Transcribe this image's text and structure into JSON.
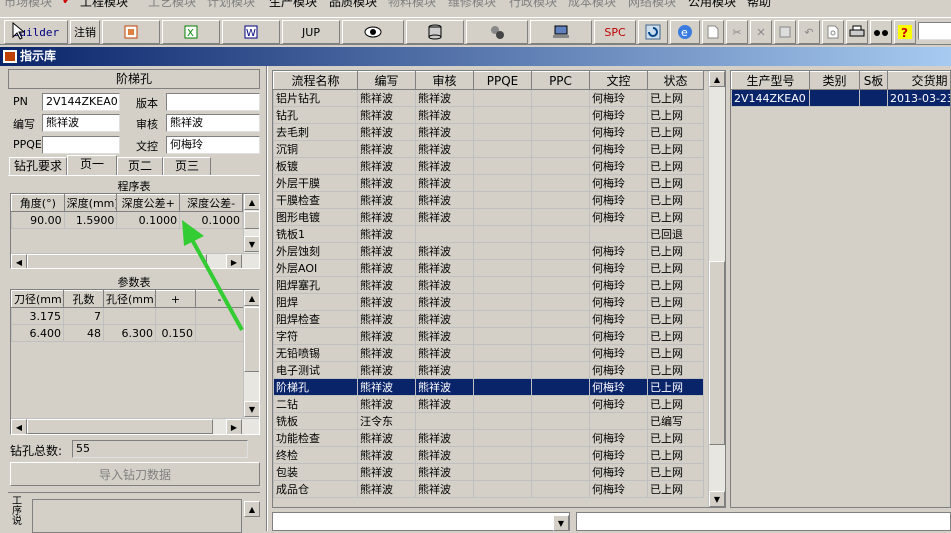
{
  "menu": [
    "市场模块",
    "工程模块",
    "工艺模块",
    "计划模块",
    "生产模块",
    "品质模块",
    "物料模块",
    "维修模块",
    "行政模块",
    "成本模块",
    "网络模块",
    "公用模块",
    "帮助"
  ],
  "toolbar": {
    "builder": "Builder",
    "logout": "注销",
    "jup": "JUP",
    "spc": "SPC"
  },
  "window_title": "指示库",
  "left": {
    "header": "阶梯孔",
    "pn_label": "PN",
    "pn_value": "2V144ZKEA0",
    "version_label": "版本",
    "version_value": "",
    "writer_label": "编写",
    "writer_value": "熊祥波",
    "review_label": "审核",
    "review_value": "熊祥波",
    "ppqe_label": "PPQE",
    "ppqe_value": "",
    "doc_label": "文控",
    "doc_value": "何梅玲",
    "tabs": [
      "钻孔要求",
      "页一",
      "页二",
      "页三"
    ],
    "program_title": "程序表",
    "program_headers": [
      "角度(°)",
      "深度(mm)",
      "深度公差+",
      "深度公差-"
    ],
    "program_rows": [
      [
        "90.00",
        "1.5900",
        "0.1000",
        "0.1000"
      ]
    ],
    "param_title": "参数表",
    "param_headers": [
      "刀径(mm)",
      "孔数",
      "孔径(mm)",
      "+",
      "-"
    ],
    "param_rows": [
      [
        "3.175",
        "7",
        "",
        "",
        ""
      ],
      [
        "6.400",
        "48",
        "6.300",
        "0.150",
        ""
      ]
    ],
    "total_label": "钻孔总数:",
    "total_value": "55",
    "import_button": "导入钻刀数据",
    "side_label": "工序说"
  },
  "process_table": {
    "headers": [
      "流程名称",
      "编写",
      "审核",
      "PPQE",
      "PPC",
      "文控",
      "状态"
    ],
    "rows": [
      [
        "铝片钻孔",
        "熊祥波",
        "熊祥波",
        "",
        "",
        "何梅玲",
        "已上网"
      ],
      [
        "钻孔",
        "熊祥波",
        "熊祥波",
        "",
        "",
        "何梅玲",
        "已上网"
      ],
      [
        "去毛刺",
        "熊祥波",
        "熊祥波",
        "",
        "",
        "何梅玲",
        "已上网"
      ],
      [
        "沉铜",
        "熊祥波",
        "熊祥波",
        "",
        "",
        "何梅玲",
        "已上网"
      ],
      [
        "板镀",
        "熊祥波",
        "熊祥波",
        "",
        "",
        "何梅玲",
        "已上网"
      ],
      [
        "外层干膜",
        "熊祥波",
        "熊祥波",
        "",
        "",
        "何梅玲",
        "已上网"
      ],
      [
        "干膜检查",
        "熊祥波",
        "熊祥波",
        "",
        "",
        "何梅玲",
        "已上网"
      ],
      [
        "图形电镀",
        "熊祥波",
        "熊祥波",
        "",
        "",
        "何梅玲",
        "已上网"
      ],
      [
        "铣板1",
        "熊祥波",
        "",
        "",
        "",
        "",
        "已回退"
      ],
      [
        "外层蚀刻",
        "熊祥波",
        "熊祥波",
        "",
        "",
        "何梅玲",
        "已上网"
      ],
      [
        "外层AOI",
        "熊祥波",
        "熊祥波",
        "",
        "",
        "何梅玲",
        "已上网"
      ],
      [
        "阻焊塞孔",
        "熊祥波",
        "熊祥波",
        "",
        "",
        "何梅玲",
        "已上网"
      ],
      [
        "阻焊",
        "熊祥波",
        "熊祥波",
        "",
        "",
        "何梅玲",
        "已上网"
      ],
      [
        "阻焊检查",
        "熊祥波",
        "熊祥波",
        "",
        "",
        "何梅玲",
        "已上网"
      ],
      [
        "字符",
        "熊祥波",
        "熊祥波",
        "",
        "",
        "何梅玲",
        "已上网"
      ],
      [
        "无铅喷锡",
        "熊祥波",
        "熊祥波",
        "",
        "",
        "何梅玲",
        "已上网"
      ],
      [
        "电子测试",
        "熊祥波",
        "熊祥波",
        "",
        "",
        "何梅玲",
        "已上网"
      ],
      [
        "阶梯孔",
        "熊祥波",
        "熊祥波",
        "",
        "",
        "何梅玲",
        "已上网"
      ],
      [
        "二钻",
        "熊祥波",
        "熊祥波",
        "",
        "",
        "何梅玲",
        "已上网"
      ],
      [
        "铣板",
        "汪令东",
        "",
        "",
        "",
        "",
        "已编写"
      ],
      [
        "功能检查",
        "熊祥波",
        "熊祥波",
        "",
        "",
        "何梅玲",
        "已上网"
      ],
      [
        "终检",
        "熊祥波",
        "熊祥波",
        "",
        "",
        "何梅玲",
        "已上网"
      ],
      [
        "包装",
        "熊祥波",
        "熊祥波",
        "",
        "",
        "何梅玲",
        "已上网"
      ],
      [
        "成品仓",
        "熊祥波",
        "熊祥波",
        "",
        "",
        "何梅玲",
        "已上网"
      ]
    ],
    "selected_row": 17
  },
  "right_table": {
    "headers": [
      "生产型号",
      "类别",
      "S板",
      "交货期"
    ],
    "rows": [
      [
        "2V144ZKEA0",
        "",
        "",
        "2013-03-23"
      ]
    ]
  },
  "colors": {
    "title_start": "#0a246a",
    "title_end": "#a6caf0",
    "selection": "#0a246a",
    "arrow": "#33cc33"
  }
}
